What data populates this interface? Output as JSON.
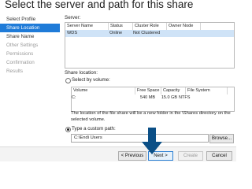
{
  "window": {
    "title": "Select the server and path for this share"
  },
  "nav": {
    "items": [
      {
        "label": "Select Profile",
        "state": "normal"
      },
      {
        "label": "Share Location",
        "state": "active"
      },
      {
        "label": "Share Name",
        "state": "normal"
      },
      {
        "label": "Other Settings",
        "state": "disabled"
      },
      {
        "label": "Permissions",
        "state": "disabled"
      },
      {
        "label": "Confirmation",
        "state": "disabled"
      },
      {
        "label": "Results",
        "state": "disabled"
      }
    ]
  },
  "server": {
    "label": "Server:",
    "columns": [
      "Server Name",
      "Status",
      "Cluster Role",
      "Owner Node"
    ],
    "rows": [
      [
        "WDS",
        "Online",
        "Not Clustered",
        ""
      ]
    ]
  },
  "location": {
    "label": "Share location:",
    "by_volume_label": "Select by volume:",
    "volume_columns": [
      "Volume",
      "Free Space",
      "Capacity",
      "File System"
    ],
    "volume_rows": [
      [
        "C:",
        "540 MB",
        "15.0 GB",
        "NTFS"
      ]
    ],
    "note": "The location of the file share will be a new folder in the \\Shares directory on the selected volume.",
    "custom_path_label": "Type a custom path:",
    "custom_path_value": "C:\\Endi Users",
    "browse_label": "Browse..."
  },
  "footer": {
    "previous_label": "< Previous",
    "next_label": "Next >",
    "create_label": "Create",
    "cancel_label": "Cancel"
  },
  "colors": {
    "accent": "#1f7bd8",
    "arrow": "#0b4f86"
  }
}
